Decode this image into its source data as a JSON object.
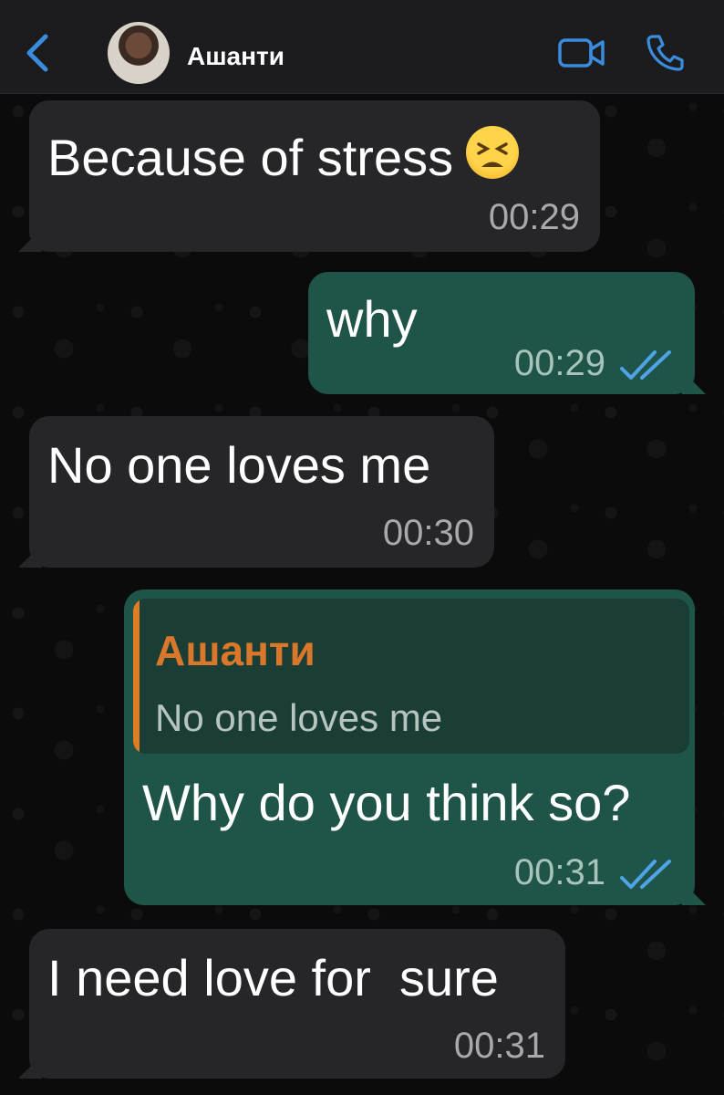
{
  "header": {
    "contact_name": "Ашанти",
    "back_icon": "chevron-left-icon",
    "video_icon": "video-camera-icon",
    "call_icon": "phone-icon",
    "accent_color": "#3a8dde"
  },
  "messages": [
    {
      "direction": "incoming",
      "text": "Because of stress",
      "emoji": "tired-face",
      "time": "00:29"
    },
    {
      "direction": "outgoing",
      "text": "why",
      "time": "00:29",
      "status": "read"
    },
    {
      "direction": "incoming",
      "text": "No one loves me",
      "time": "00:30"
    },
    {
      "direction": "outgoing",
      "reply_to": {
        "author": "Ашанти",
        "text": "No one loves me"
      },
      "text": "Why do you think so?",
      "time": "00:31",
      "status": "read"
    },
    {
      "direction": "incoming",
      "text": "I need love for  sure",
      "time": "00:31"
    }
  ],
  "colors": {
    "incoming_bubble": "#262628",
    "outgoing_bubble": "#1f5548",
    "reply_accent": "#e07d24",
    "read_ticks": "#4fa3e6"
  }
}
